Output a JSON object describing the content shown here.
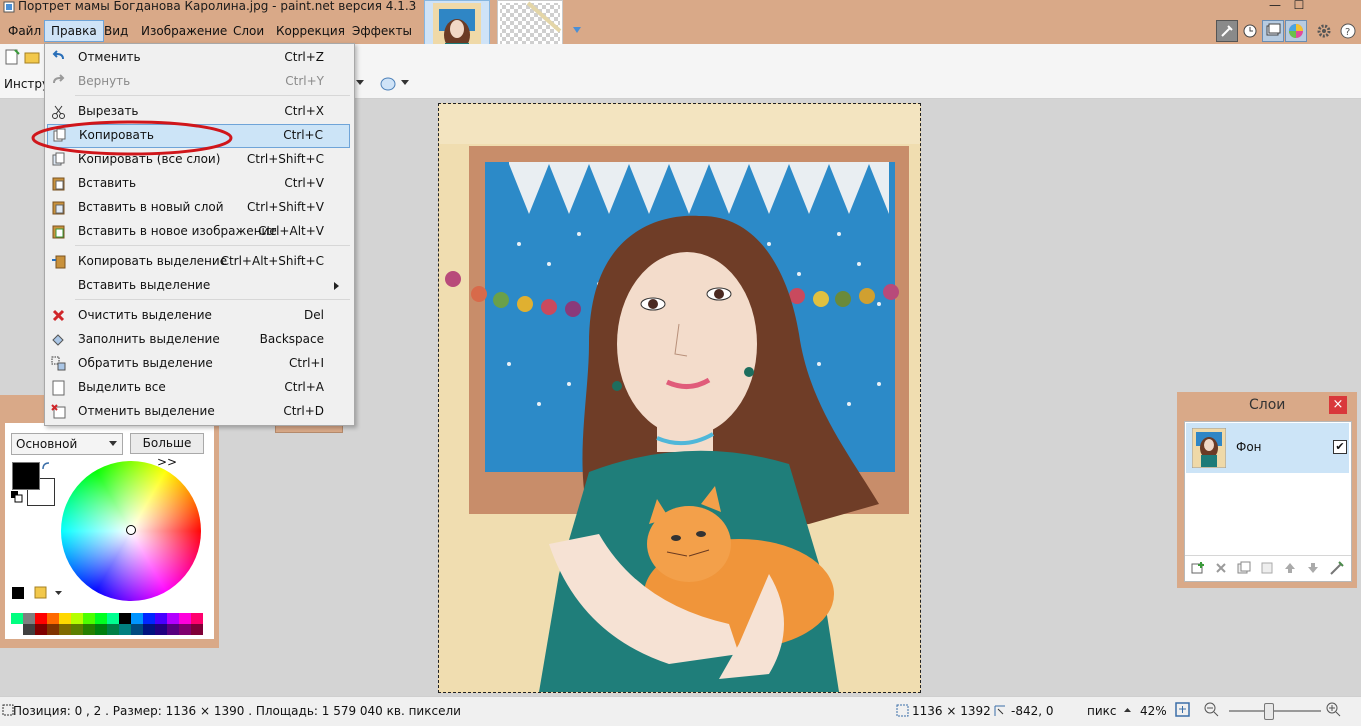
{
  "window": {
    "title": "Портрет мамы Богданова Каролина.jpg - paint.net версия 4.1.3",
    "minimize_glyph": "—",
    "maximize_glyph": "☐"
  },
  "menubar": [
    "Файл",
    "Правка",
    "Вид",
    "Изображение",
    "Слои",
    "Коррекция",
    "Эффекты"
  ],
  "toolbar": {
    "tool_label": "Инстру"
  },
  "edit_menu": {
    "items": [
      {
        "label": "Отменить",
        "shortcut": "Ctrl+Z",
        "icon": "undo-icon",
        "disabled": false
      },
      {
        "label": "Вернуть",
        "shortcut": "Ctrl+Y",
        "icon": "redo-icon",
        "disabled": true
      },
      {
        "label": "Вырезать",
        "shortcut": "Ctrl+X",
        "icon": "scissors-icon",
        "disabled": false
      },
      {
        "label": "Копировать",
        "shortcut": "Ctrl+C",
        "icon": "copy-icon",
        "disabled": false,
        "highlighted": true
      },
      {
        "label": "Копировать (все слои)",
        "shortcut": "Ctrl+Shift+C",
        "icon": "copy-merged-icon",
        "disabled": false
      },
      {
        "label": "Вставить",
        "shortcut": "Ctrl+V",
        "icon": "paste-icon",
        "disabled": false
      },
      {
        "label": "Вставить в новый слой",
        "shortcut": "Ctrl+Shift+V",
        "icon": "paste-new-layer-icon",
        "disabled": false
      },
      {
        "label": "Вставить в новое изображение",
        "shortcut": "Ctrl+Alt+V",
        "icon": "paste-new-image-icon",
        "disabled": false
      },
      {
        "label": "Копировать выделение",
        "shortcut": "Ctrl+Alt+Shift+C",
        "icon": "copy-selection-icon",
        "disabled": false
      },
      {
        "label": "Вставить выделение",
        "shortcut": "",
        "icon": "",
        "disabled": false,
        "submenu": true
      },
      {
        "label": "Очистить выделение",
        "shortcut": "Del",
        "icon": "erase-selection-icon",
        "disabled": false
      },
      {
        "label": "Заполнить выделение",
        "shortcut": "Backspace",
        "icon": "fill-selection-icon",
        "disabled": false
      },
      {
        "label": "Обратить выделение",
        "shortcut": "Ctrl+I",
        "icon": "invert-selection-icon",
        "disabled": false
      },
      {
        "label": "Выделить все",
        "shortcut": "Ctrl+A",
        "icon": "select-all-icon",
        "disabled": false
      },
      {
        "label": "Отменить выделение",
        "shortcut": "Ctrl+D",
        "icon": "deselect-icon",
        "disabled": false
      }
    ]
  },
  "colors_panel": {
    "mode": "Основной",
    "more_button": "Больше >>"
  },
  "layers_panel": {
    "title": "Слои",
    "layers": [
      {
        "name": "Фон",
        "visible": true
      }
    ]
  },
  "status": {
    "position_info": "Позиция: 0 , 2 . Размер: 1136  × 1390 . Площадь: 1 579 040 кв. пиксели",
    "image_size": "1136 × 1392",
    "cursor": "-842, 0",
    "units": "пикс",
    "zoom": "42%",
    "zoom_level": 0.42
  },
  "colors": {
    "chrome": "#d9a988",
    "highlight": "#cce4f7",
    "highlight_border": "#6fa4d8",
    "annotation_ellipse": "#d0161b"
  }
}
